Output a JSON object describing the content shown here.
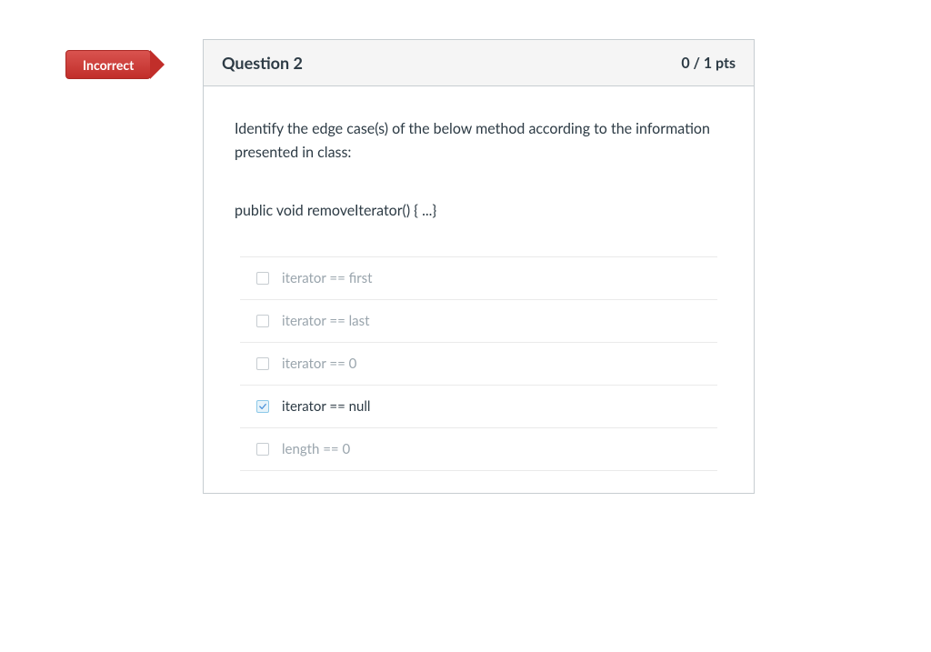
{
  "badge": {
    "label": "Incorrect"
  },
  "header": {
    "title": "Question 2",
    "points": "0 / 1 pts"
  },
  "prompt": "Identify the edge case(s) of the below method according to the information presented in class:",
  "code": "public void removeIterator() { ...}",
  "answers": [
    {
      "text": "iterator == first",
      "checked": false
    },
    {
      "text": "iterator == last",
      "checked": false
    },
    {
      "text": "iterator == 0",
      "checked": false
    },
    {
      "text": "iterator == null",
      "checked": true
    },
    {
      "text": "length == 0",
      "checked": false
    }
  ]
}
